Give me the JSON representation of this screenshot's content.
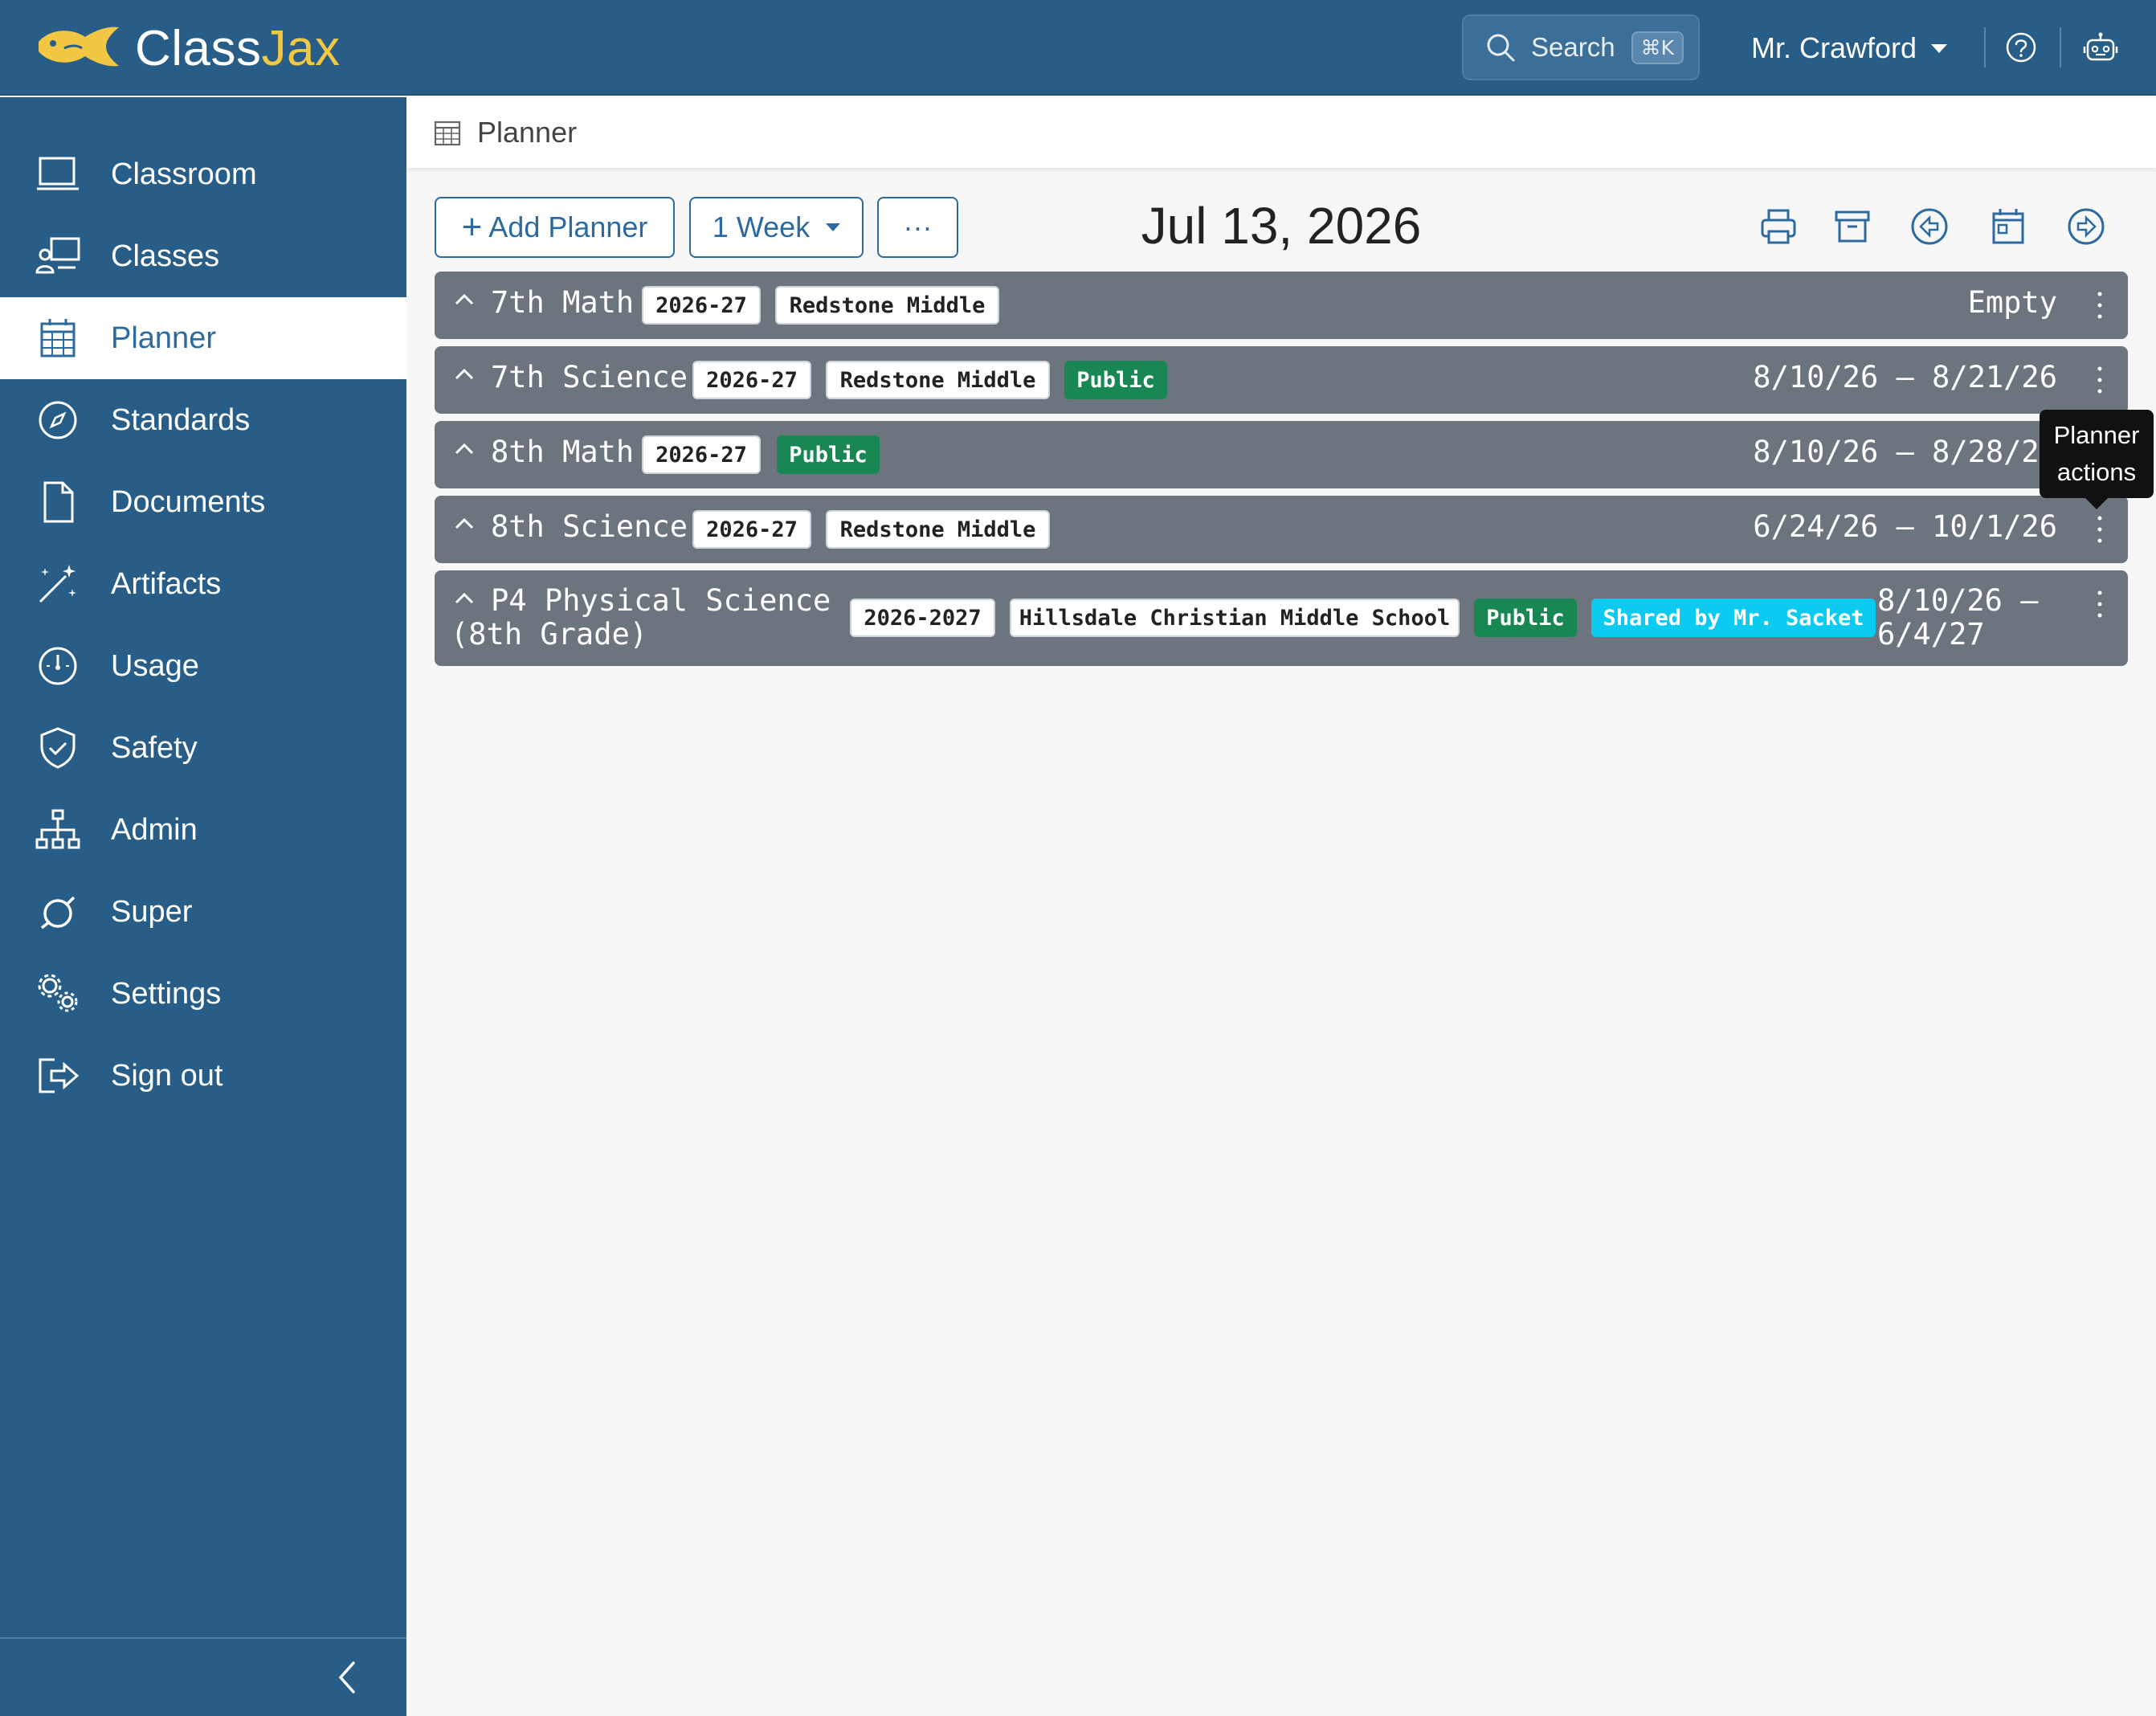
{
  "app": {
    "logo_class": "Class",
    "logo_jax": "Jax",
    "brand_color": "#275d87",
    "accent_color": "#f2c744"
  },
  "header": {
    "search_label": "Search",
    "search_shortcut": "⌘K",
    "user_name": "Mr. Crawford",
    "help_icon": "question-circle-icon",
    "assistant_icon": "robot-icon"
  },
  "sidebar": {
    "items": [
      {
        "label": "Classroom",
        "icon": "classroom-icon"
      },
      {
        "label": "Classes",
        "icon": "classes-icon"
      },
      {
        "label": "Planner",
        "icon": "calendar-icon",
        "active": true
      },
      {
        "label": "Standards",
        "icon": "compass-icon"
      },
      {
        "label": "Documents",
        "icon": "document-icon"
      },
      {
        "label": "Artifacts",
        "icon": "magic-wand-icon"
      },
      {
        "label": "Usage",
        "icon": "gauge-icon"
      },
      {
        "label": "Safety",
        "icon": "shield-check-icon"
      },
      {
        "label": "Admin",
        "icon": "sitemap-icon"
      },
      {
        "label": "Super",
        "icon": "orbit-icon"
      },
      {
        "label": "Settings",
        "icon": "gears-icon"
      },
      {
        "label": "Sign out",
        "icon": "sign-out-icon"
      }
    ]
  },
  "breadcrumb": {
    "label": "Planner"
  },
  "toolbar": {
    "add_planner": "Add Planner",
    "range": "1 Week",
    "more": "···",
    "date": "Jul 13, 2026"
  },
  "planners": [
    {
      "title": "7th Math",
      "year": "2026-27",
      "school": "Redstone Middle",
      "dates": "Empty"
    },
    {
      "title": "7th Science",
      "year": "2026-27",
      "school": "Redstone Middle",
      "public": "Public",
      "dates": "8/10/26 – 8/21/26"
    },
    {
      "title": "8th Math",
      "year": "2026-27",
      "public": "Public",
      "dates": "8/10/26 – 8/28/26"
    },
    {
      "title": "8th Science",
      "year": "2026-27",
      "school": "Redstone Middle",
      "dates": "6/24/26 – 10/1/26"
    },
    {
      "title_line1": "P4 Physical Science",
      "title_line2": "(8th Grade)",
      "year": "2026-2027",
      "school": "Hillsdale Christian Middle School",
      "public": "Public",
      "shared": "Shared by Mr. Sacket",
      "dates_line1": "8/10/26 –",
      "dates_line2": "6/4/27"
    }
  ],
  "tooltip": {
    "line1": "Planner",
    "line2": "actions"
  }
}
